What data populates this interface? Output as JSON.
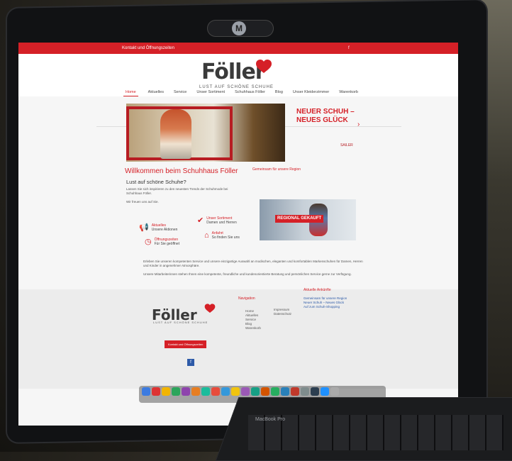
{
  "device": {
    "brand_label": "MacBook Pro"
  },
  "website": {
    "topbar": {
      "contact_text": "Kontakt und Öffnungszeiten",
      "facebook_label": "f"
    },
    "logo": {
      "name": "Föller",
      "slogan": "LUST AUF SCHÖNE SCHUHE"
    },
    "nav_items": [
      "Home",
      "Aktuelles",
      "Service",
      "Unser Sortiment",
      "Schuhhaus Föller",
      "Blog",
      "Unser Kleiderzimmer",
      "Warenkorb"
    ],
    "hero": {
      "promo_text_line1": "NEUER SCHUH –",
      "promo_text_line2": "NEUES GLÜCK",
      "brand_badge": "SAILER"
    },
    "welcome": {
      "title": "Willkommen beim Schuhhaus Föller",
      "subtitle": "Lust auf schöne Schuhe?",
      "intro": "Lassen Sie sich inspirieren zu den neuesten Trends der Schuhmode bei Schuhhaus Föller.",
      "greeting": "Wir freuen uns auf Sie."
    },
    "news": {
      "title": "Gemeinsam für unsere Region"
    },
    "features": [
      {
        "icon": "megaphone-icon",
        "label": "Aktuelles",
        "sub": "Unsere Aktionen"
      },
      {
        "icon": "check-icon",
        "label": "Unser Sortiment",
        "sub": "Damen und Herren"
      },
      {
        "icon": "clock-icon",
        "label": "Öffnungszeiten",
        "sub": "Für Sie geöffnet"
      },
      {
        "icon": "house-icon",
        "label": "Anfahrt",
        "sub": "So finden Sie uns"
      }
    ],
    "regional_badge": "REGIONAL GEKAUFT",
    "body_text_1": "Erleben Sie unseren kompetenten Service und unsere einzigartige Auswahl an modischen, eleganten und komfortablen Markenschuhen für Damen, Herren und Kinder in angenehmer Atmosphäre.",
    "body_text_2": "Unsere Mitarbeiterinnen stehen Ihnen eine kompetente, freundliche und kundenorientierte Beratung und persönlichen Service gerne zur Verfügung.",
    "footer": {
      "logo_name": "Föller",
      "slogan": "LUST AUF SCHÖNE SCHUHE",
      "button": "Kontakt und Öffnungszeiten",
      "nav_title": "Navigation",
      "news_title": "Aktuelle Ankünfte",
      "nav_links": [
        "Home",
        "Aktuelles",
        "Service",
        "Blog",
        "Warenkorb",
        "Impressum",
        "Datenschutz"
      ],
      "news_links": [
        "Gemeinsam für unsere Region",
        "Neuer Schuh – Neues Glück",
        "Auf zum Schuh-Shopping"
      ],
      "facebook_label": "f"
    }
  },
  "colors": {
    "brand_red": "#d52027",
    "screen_bg": "#f6f6f6",
    "bezel": "#111214"
  }
}
